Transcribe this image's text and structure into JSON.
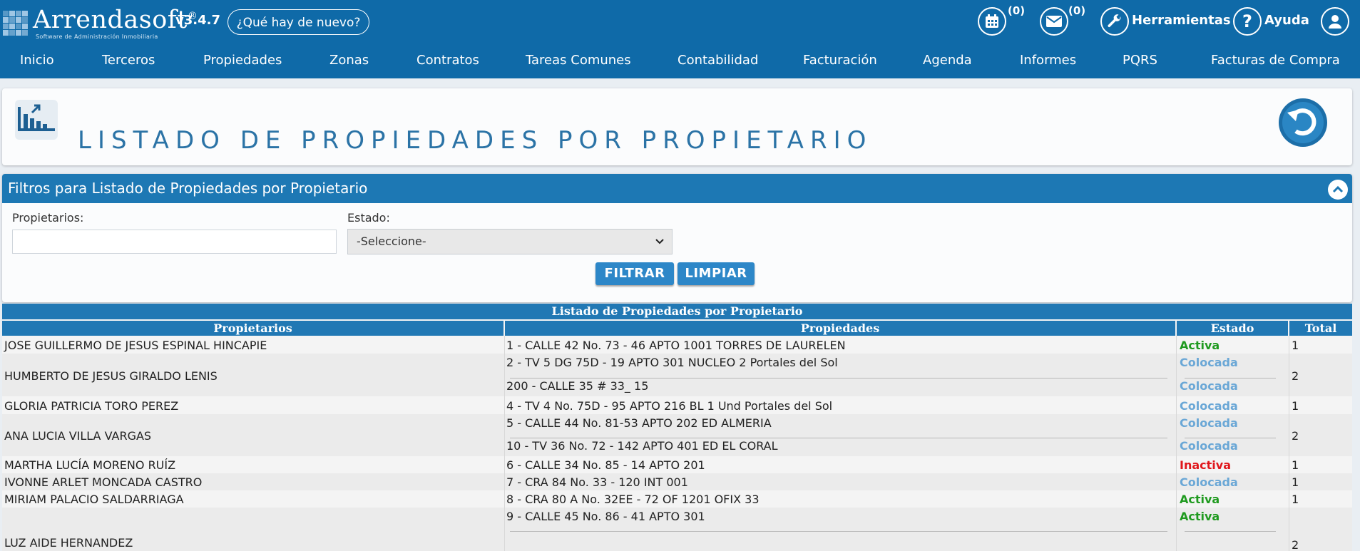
{
  "app": {
    "name": "Arrendasoft",
    "trademark": "®",
    "subtitle": "Software de Administración Inmobiliaria",
    "version": "v3.4.7",
    "news_button": "¿Qué hay de nuevo?"
  },
  "toolbar": {
    "calendar_count": "(0)",
    "messages_count": "(0)",
    "tools_label": "Herramientas",
    "help_label": "Ayuda",
    "icons": [
      "calendar-icon",
      "envelope-icon",
      "wrench-icon",
      "question-icon",
      "user-icon"
    ]
  },
  "nav": [
    "Inicio",
    "Terceros",
    "Propiedades",
    "Zonas",
    "Contratos",
    "Tareas Comunes",
    "Contabilidad",
    "Facturación",
    "Agenda",
    "Informes",
    "PQRS",
    "Facturas de Compra"
  ],
  "page": {
    "title": "LISTADO DE PROPIEDADES POR PROPIETARIO"
  },
  "filters": {
    "title": "Filtros para Listado de Propiedades por Propietario",
    "owners_label": "Propietarios:",
    "owners_value": "",
    "state_label": "Estado:",
    "state_selected": "-Seleccione-",
    "filter_button": "FILTRAR",
    "clear_button": "LIMPIAR"
  },
  "table": {
    "caption": "Listado de Propiedades por Propietario",
    "headers": [
      "Propietarios",
      "Propiedades",
      "Estado",
      "Total"
    ],
    "rows": [
      {
        "owner": "JOSE GUILLERMO DE JESUS ESPINAL HINCAPIE",
        "properties": [
          {
            "name": "1 - CALLE 42 No. 73 - 46 APTO 1001 TORRES DE LAURELEN",
            "state": "Activa"
          }
        ],
        "total": "1"
      },
      {
        "owner": "HUMBERTO DE JESUS GIRALDO LENIS",
        "properties": [
          {
            "name": "2 - TV 5 DG 75D - 19 APTO 301 NUCLEO 2 Portales del Sol",
            "state": "Colocada"
          },
          {
            "name": "200 - CALLE 35 # 33_ 15",
            "state": "Colocada"
          }
        ],
        "total": "2"
      },
      {
        "owner": "GLORIA PATRICIA TORO PEREZ",
        "properties": [
          {
            "name": "4 - TV 4 No. 75D - 95 APTO 216 BL 1 Und Portales del Sol",
            "state": "Colocada"
          }
        ],
        "total": "1"
      },
      {
        "owner": "ANA LUCIA VILLA VARGAS",
        "properties": [
          {
            "name": "5 - CALLE 44 No. 81-53 APTO 202 ED ALMERIA",
            "state": "Colocada"
          },
          {
            "name": "10 - TV 36 No. 72 - 142 APTO 401 ED EL CORAL",
            "state": "Colocada"
          }
        ],
        "total": "2"
      },
      {
        "owner": "MARTHA LUCÍA MORENO RUÍZ",
        "properties": [
          {
            "name": "6 - CALLE 34 No. 85 - 14 APTO 201",
            "state": "Inactiva"
          }
        ],
        "total": "1"
      },
      {
        "owner": "IVONNE ARLET MONCADA CASTRO",
        "properties": [
          {
            "name": "7 - CRA 84 No. 33 - 120 INT 001",
            "state": "Colocada"
          }
        ],
        "total": "1"
      },
      {
        "owner": "MIRIAM PALACIO SALDARRIAGA",
        "properties": [
          {
            "name": "8 - CRA 80 A No. 32EE - 72 OF 1201 OFIX 33",
            "state": "Activa"
          }
        ],
        "total": "1"
      },
      {
        "owner": "LUZ AIDE HERNANDEZ",
        "properties": [
          {
            "name": "9 - CALLE 45 No. 86 - 41 APTO 301",
            "state": "Activa"
          }
        ],
        "total": "2"
      }
    ]
  },
  "colors": {
    "brand": "#0f6aa8",
    "header_blue": "#1d78b4",
    "activa": "#1f9a1f",
    "colocada": "#6aa7d6",
    "inactiva": "#e0161b"
  }
}
